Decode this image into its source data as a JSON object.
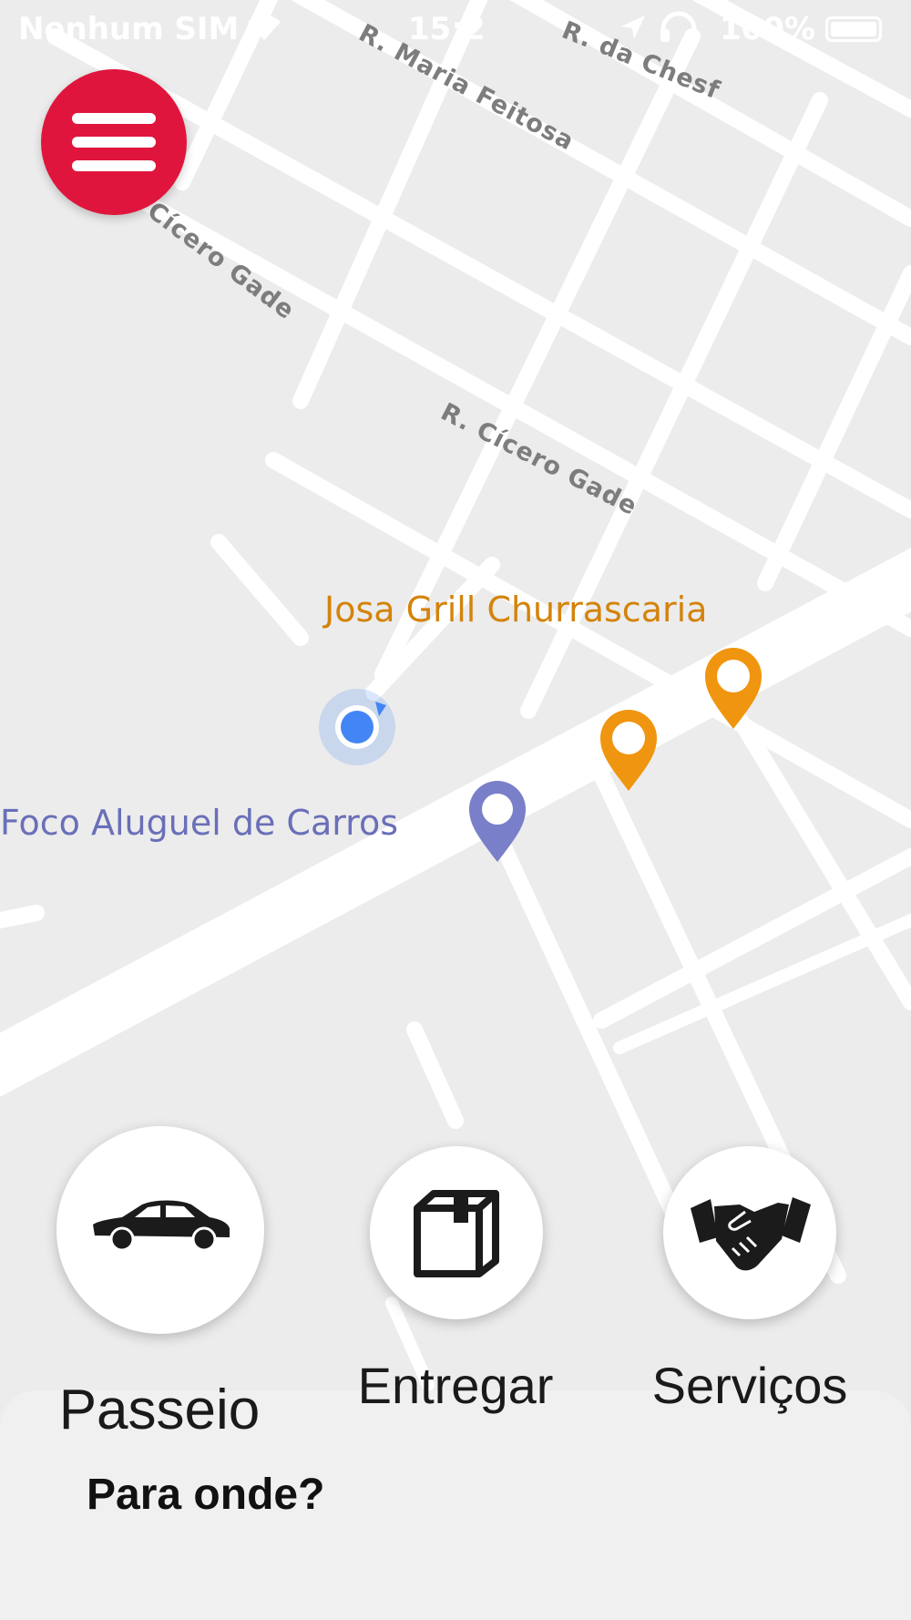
{
  "status_bar": {
    "carrier": "Nenhum SIM",
    "time": "15:2",
    "battery": "100%",
    "wifi_icon": "wifi-icon",
    "location_icon": "location-arrow-icon",
    "headphones_icon": "headphones-icon",
    "battery_icon": "battery-icon"
  },
  "map": {
    "streets": [
      "R. da Chesf",
      "R. Maria Feitosa",
      "Cícero Gade",
      "R. Cícero Gade"
    ],
    "places": [
      {
        "name": "Josa Grill Churrascaria",
        "color": "#d4830b"
      },
      {
        "name": "Foco Aluguel de Carros",
        "color": "#6a6fb8"
      }
    ],
    "user_location_color": "#4285f4"
  },
  "menu": {
    "icon": "hamburger-menu-icon",
    "color": "#e0153d"
  },
  "services": [
    {
      "label": "Passeio",
      "icon": "car-icon"
    },
    {
      "label": "Entregar",
      "icon": "package-box-icon"
    },
    {
      "label": "Serviços",
      "icon": "handshake-icon"
    }
  ],
  "bottom_sheet": {
    "prompt": "Para onde?"
  }
}
